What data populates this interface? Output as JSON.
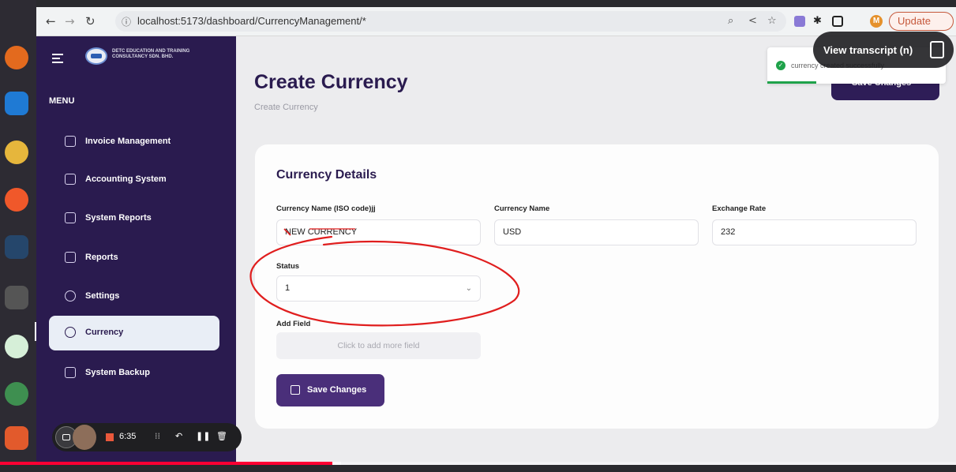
{
  "browser": {
    "url": "localhost:5173/dashboard/CurrencyManagement/*",
    "update_label": "Update",
    "profile_initial": "M"
  },
  "sidebar": {
    "logo_text": "DETC EDUCATION AND TRAINING CONSULTANCY SDN. BHD.",
    "menu_label": "MENU",
    "items": [
      {
        "label": "Invoice Management"
      },
      {
        "label": "Accounting System"
      },
      {
        "label": "System Reports"
      },
      {
        "label": "Reports"
      },
      {
        "label": "Settings"
      },
      {
        "label": "Currency",
        "active": true
      },
      {
        "label": "System Backup"
      }
    ]
  },
  "main": {
    "title": "Create Currency",
    "breadcrumb": "Create Currency",
    "top_save_label": "Save Changes",
    "card": {
      "title": "Currency Details",
      "iso_label": "Currency Name (ISO code)jj",
      "iso_value": "NEW CURRENCY",
      "name_label": "Currency Name",
      "name_value": "USD",
      "rate_label": "Exchange Rate",
      "rate_value": "232",
      "status_label": "Status",
      "status_value": "1",
      "add_field_label": "Add Field",
      "add_field_button": "Click to add more field",
      "save_label": "Save Changes"
    }
  },
  "toast": {
    "message": "currency created successfully",
    "type": "success"
  },
  "overlay": {
    "transcript_label": "View transcript (n)"
  },
  "recorder": {
    "time": "6:35"
  },
  "video": {
    "progress": 0.348,
    "buffered": 0.357
  },
  "colors": {
    "sidebar_bg": "#2a1b4f",
    "primary": "#4a2f7a",
    "annotation": "#e01e1e",
    "success": "#1fa24a"
  }
}
